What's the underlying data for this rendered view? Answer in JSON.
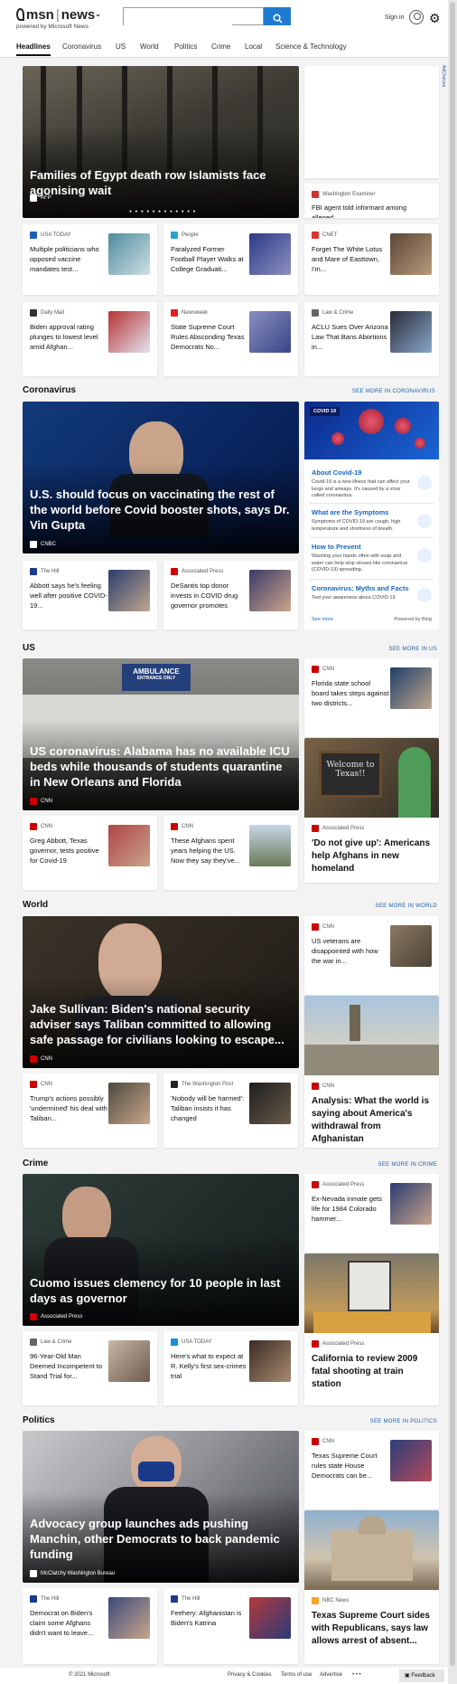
{
  "header": {
    "brand": "msn",
    "section": "news",
    "powered_by": "powered by Microsoft News",
    "search_placeholder": "",
    "sign_in": "Sign in"
  },
  "nav": {
    "tabs": [
      "Headlines",
      "Coronavirus",
      "US",
      "World",
      "Politics",
      "Crime",
      "Local",
      "Science & Technology"
    ]
  },
  "adchoices": "AdChoices",
  "headlines": {
    "hero": {
      "title": "Families of Egypt death row Islamists face agonising wait",
      "source": "AFP"
    },
    "side": {
      "source": "Washington Examiner",
      "title": "FBI agent told informant among alleged..."
    },
    "cards": [
      {
        "source": "USA TODAY",
        "title": "Multiple politicians who opposed vaccine mandates test..."
      },
      {
        "source": "People",
        "title": "Paralyzed Former Football Player Walks at College Graduati..."
      },
      {
        "source": "CNET",
        "title": "Forget The White Lotus and Mare of Easttown, I'm..."
      },
      {
        "source": "Daily Mail",
        "title": "Biden approval rating plunges to lowest level amid Afghan..."
      },
      {
        "source": "Newsweek",
        "title": "State Supreme Court Rules Absconding Texas Democrats No..."
      },
      {
        "source": "Law & Crime",
        "title": "ACLU Sues Over Arizona Law That Bans Abortions in..."
      }
    ]
  },
  "coronavirus": {
    "title": "Coronavirus",
    "see_more": "SEE MORE IN CORONAVIRUS",
    "hero": {
      "title": "U.S. should focus on vaccinating the rest of the world before Covid booster shots, says Dr. Vin Gupta",
      "source": "CNBC"
    },
    "cards": [
      {
        "source": "The Hill",
        "title": "Abbott says he's feeling well after positive COVID-19..."
      },
      {
        "source": "Associated Press",
        "title": "DeSantis top donor invests in COVID drug governor promotes"
      }
    ],
    "widget": {
      "tag": "COVID 19",
      "items": [
        {
          "title": "About Covid-19",
          "desc": "Covid-19 is a new illness that can affect your lungs and airways. It's caused by a virus called coronavirus."
        },
        {
          "title": "What are the Symptoms",
          "desc": "Symptoms of COVID-19 are cough, high temperature and shortness of breath."
        },
        {
          "title": "How to Prevent",
          "desc": "Washing your hands often with soap and water can help stop viruses like coronavirus (COVID-19) spreading."
        },
        {
          "title": "Coronavirus: Myths and Facts",
          "desc": "Test your awareness about COVID-19"
        }
      ],
      "see_more": "See more",
      "powered": "Powered by Bing"
    }
  },
  "us": {
    "title": "US",
    "see_more": "SEE MORE IN US",
    "hero": {
      "title": "US coronavirus: Alabama has no available ICU beds while thousands of students quarantine in New Orleans and Florida",
      "source": "CNN",
      "sign": "AMBULANCE",
      "sign2": "ENTRANCE ONLY"
    },
    "side_card": {
      "source": "CNN",
      "title": "Florida state school board takes steps against two districts..."
    },
    "tall": {
      "source": "Associated Press",
      "title": "'Do not give up': Americans help Afghans in new homeland",
      "board": "Welcome to Texas!!"
    },
    "cards": [
      {
        "source": "CNN",
        "title": "Greg Abbott, Texas governor, tests positive for Covid-19"
      },
      {
        "source": "CNN",
        "title": "These Afghans spent years helping the US. Now they say they've..."
      }
    ]
  },
  "world": {
    "title": "World",
    "see_more": "SEE MORE IN WORLD",
    "hero": {
      "title": "Jake Sullivan: Biden's national security adviser says Taliban committed to allowing safe passage for civilians looking to escape...",
      "source": "CNN"
    },
    "side_card": {
      "source": "CNN",
      "title": "US veterans are disappointed with how the war in..."
    },
    "tall": {
      "source": "CNN",
      "title": "Analysis: What the world is saying about America's withdrawal from Afghanistan"
    },
    "cards": [
      {
        "source": "CNN",
        "title": "Trump's actions possibly 'undermined' his deal with Taliban..."
      },
      {
        "source": "The Washington Post",
        "title": "'Nobody will be harmed': Taliban insists it has changed"
      }
    ]
  },
  "crime": {
    "title": "Crime",
    "see_more": "SEE MORE IN CRIME",
    "hero": {
      "title": "Cuomo issues clemency for 10 people in last days as governor",
      "source": "Associated Press"
    },
    "side_card": {
      "source": "Associated Press",
      "title": "Ex-Nevada inmate gets life for 1984 Colorado hammer..."
    },
    "tall": {
      "source": "Associated Press",
      "title": "California to review 2009 fatal shooting at train station"
    },
    "cards": [
      {
        "source": "Law & Crime",
        "title": "96-Year-Old Man Deemed Incompetent to Stand Trial for..."
      },
      {
        "source": "USA TODAY",
        "title": "Here's what to expect at R. Kelly's first sex-crimes trial"
      }
    ]
  },
  "politics": {
    "title": "Politics",
    "see_more": "SEE MORE IN POLITICS",
    "hero": {
      "title": "Advocacy group launches ads pushing Manchin, other Democrats to back pandemic funding",
      "source": "McClatchy Washington Bureau"
    },
    "side_card": {
      "source": "CNN",
      "title": "Texas Supreme Court rules state House Democrats can be..."
    },
    "tall": {
      "source": "NBC News",
      "title": "Texas Supreme Court sides with Republicans, says law allows arrest of absent..."
    },
    "cards": [
      {
        "source": "The Hill",
        "title": "Democrat on Biden's claim some Afghans didn't want to leave..."
      },
      {
        "source": "The Hill",
        "title": "Feehery: Afghanistan is Biden's Katrina"
      }
    ]
  },
  "footer": {
    "copyright": "© 2021 Microsoft",
    "privacy": "Privacy & Cookies",
    "terms": "Terms of use",
    "advertise": "Advertise",
    "more": "• • •",
    "feedback": "Feedback"
  },
  "colors": {
    "accent": "#1f7ad1",
    "link": "#1f5fa8",
    "cnn": "#cc0000"
  }
}
